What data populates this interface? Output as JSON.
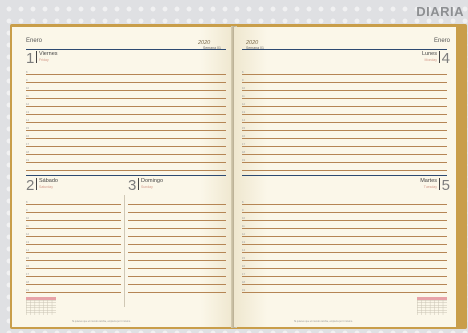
{
  "label": "DIARIA",
  "left_page": {
    "month": "Enero",
    "year": "2020",
    "week": "Semana 01",
    "days": [
      {
        "num": "1",
        "name": "Viernes",
        "sub": "Friday"
      },
      {
        "num": "2",
        "name": "Sábado",
        "sub": "Saturday"
      },
      {
        "num": "3",
        "name": "Domingo",
        "sub": "Sunday"
      }
    ],
    "footer": "Si quieres que el mundo cambie, empieza por ti mismo."
  },
  "right_page": {
    "month": "Enero",
    "year": "2020",
    "week": "Semana 01",
    "days": [
      {
        "num": "4",
        "name": "Lunes",
        "sub": "Monday"
      },
      {
        "num": "5",
        "name": "Martes",
        "sub": "Tuesday"
      }
    ],
    "footer": "Si quieres que el mundo cambie, empieza por ti mismo."
  },
  "hours": [
    "8",
    "9",
    "10",
    "11",
    "12",
    "13",
    "14",
    "15",
    "16",
    "17",
    "18",
    "19"
  ],
  "colors": {
    "cover": "#c99e4a",
    "paper": "#fbf7e9",
    "rule": "#2d4a72",
    "line": "#b58554",
    "accent": "#e7a3a8"
  }
}
